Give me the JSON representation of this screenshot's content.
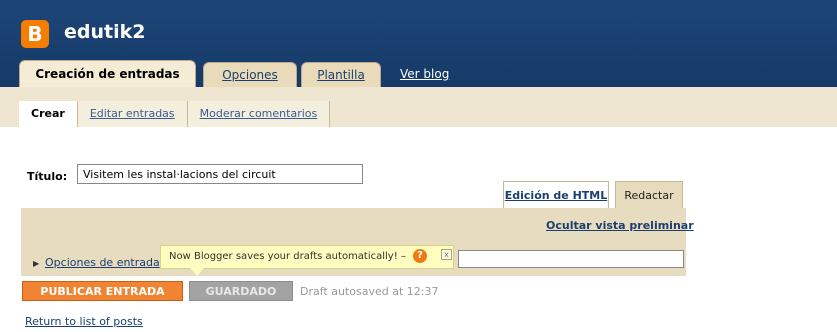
{
  "header": {
    "logo_letter": "B",
    "blog_name": "edutik2",
    "tabs": [
      {
        "label": "Creación de entradas",
        "active": true
      },
      {
        "label": "Opciones",
        "active": false
      },
      {
        "label": "Plantilla",
        "active": false
      }
    ],
    "view_blog": "Ver blog"
  },
  "subnav": {
    "items": [
      {
        "label": "Crear",
        "active": true
      },
      {
        "label": "Editar entradas",
        "active": false
      },
      {
        "label": "Moderar comentarios",
        "active": false
      }
    ]
  },
  "post": {
    "title_label": "Título:",
    "title_value": "Visitem les instal·lacions del circuit"
  },
  "editor": {
    "tab_html": "Edición de HTML",
    "tab_compose": "Redactar",
    "hide_preview": "Ocultar vista preliminar",
    "post_options": "Opciones de entrada",
    "labels_value": ""
  },
  "tooltip": {
    "text": "Now Blogger saves your drafts automatically! –",
    "help_icon": "?",
    "close_icon": "x"
  },
  "actions": {
    "publish": "PUBLICAR ENTRADA",
    "saved": "GUARDADO",
    "autosave_status": "Draft autosaved at 12:37",
    "return": "Return to list of posts"
  },
  "colors": {
    "header_bg": "#1a3f70",
    "tab_bg": "#e9dbb9",
    "publish_orange": "#f08432",
    "saved_gray": "#a3a3a3",
    "tooltip_bg": "#fffcbf"
  }
}
